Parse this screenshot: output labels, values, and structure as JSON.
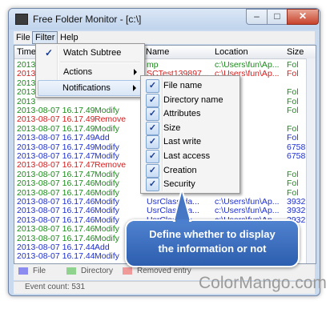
{
  "window": {
    "title": "Free Folder Monitor - [c:\\]",
    "controls": {
      "minimize": "–",
      "maximize": "□",
      "close": "✕"
    }
  },
  "menubar": {
    "items": [
      "File",
      "Filter",
      "Help"
    ]
  },
  "columns": [
    "Times",
    "Name",
    "Location",
    "Size"
  ],
  "rows": [
    {
      "time": "2013",
      "action": "",
      "name": "mp",
      "location": "c:\\Users\\fun\\Ap...",
      "size": "Fol",
      "color": "#1a8a1a"
    },
    {
      "time": "2013",
      "action": "",
      "name": "SCTest139897...",
      "location": "c:\\Users\\fun\\Ap...",
      "size": "Fol",
      "color": "#d41c1c"
    },
    {
      "time": "2013",
      "action": "",
      "name": "",
      "location": "",
      "size": "",
      "color": "#1a8a1a"
    },
    {
      "time": "2013",
      "action": "",
      "name": "",
      "location": "",
      "size": "Fol",
      "color": "#1a8a1a"
    },
    {
      "time": "2013",
      "action": "",
      "name": "",
      "location": "",
      "size": "Fol",
      "color": "#1a8a1a"
    },
    {
      "time": "2013-08-07 16.17.49",
      "action": "Modify",
      "name": "",
      "location": "",
      "size": "Fol",
      "color": "#1a8a1a"
    },
    {
      "time": "2013-08-07 16.17.49",
      "action": "Remove",
      "name": "",
      "location": "",
      "size": "",
      "color": "#d41c1c"
    },
    {
      "time": "2013-08-07 16.17.49",
      "action": "Modify",
      "name": "",
      "location": "",
      "size": "Fol",
      "color": "#1a8a1a"
    },
    {
      "time": "2013-08-07 16.17.49",
      "action": "Add",
      "name": "",
      "location": "",
      "size": "Fol",
      "color": "#1e2fd0"
    },
    {
      "time": "2013-08-07 16.17.49",
      "action": "Modify",
      "name": "",
      "location": "",
      "size": "6758",
      "color": "#1e2fd0"
    },
    {
      "time": "2013-08-07 16.17.47",
      "action": "Modify",
      "name": "",
      "location": "",
      "size": "6758",
      "color": "#1e2fd0"
    },
    {
      "time": "2013-08-07 16.17.47",
      "action": "Remove",
      "name": "",
      "location": "",
      "size": "",
      "color": "#d41c1c"
    },
    {
      "time": "2013-08-07 16.17.47",
      "action": "Modify",
      "name": "",
      "location": "",
      "size": "Fol",
      "color": "#1a8a1a"
    },
    {
      "time": "2013-08-07 16.17.46",
      "action": "Modify",
      "name": "",
      "location": "",
      "size": "Fol",
      "color": "#1a8a1a"
    },
    {
      "time": "2013-08-07 16.17.46",
      "action": "Modify",
      "name": "",
      "location": "",
      "size": "Fol",
      "color": "#1a8a1a"
    },
    {
      "time": "2013-08-07 16.17.46",
      "action": "Modify",
      "name": "UsrClass.da...",
      "location": "c:\\Users\\fun\\Ap...",
      "size": "3932",
      "color": "#1e2fd0"
    },
    {
      "time": "2013-08-07 16.17.46",
      "action": "Modify",
      "name": "UsrClass.da...",
      "location": "c:\\Users\\fun\\Ap...",
      "size": "3932",
      "color": "#1e2fd0"
    },
    {
      "time": "2013-08-07 16.17.46",
      "action": "Modify",
      "name": "UsrClass.da...",
      "location": "c:\\Users\\fun\\Ap...",
      "size": "3932",
      "color": "#1e2fd0"
    },
    {
      "time": "2013-08-07 16.17.46",
      "action": "Modify",
      "name": "",
      "location": "",
      "size": "Fol",
      "color": "#1a8a1a"
    },
    {
      "time": "2013-08-07 16.17.46",
      "action": "Modify",
      "name": "",
      "location": "",
      "size": "Fol",
      "color": "#1a8a1a"
    },
    {
      "time": "2013-08-07 16.17.44",
      "action": "Add",
      "name": "",
      "location": "",
      "size": "",
      "color": "#1e2fd0"
    },
    {
      "time": "2013-08-07 16.17.44",
      "action": "Modify",
      "name": "",
      "location": "",
      "size": "",
      "color": "#1e2fd0"
    }
  ],
  "filter_menu": {
    "items": [
      {
        "label": "Watch Subtree",
        "checked": true
      },
      {
        "label": "Actions",
        "submenu": true
      },
      {
        "label": "Notifications",
        "submenu": true
      }
    ]
  },
  "notifications_menu": {
    "items": [
      "File name",
      "Directory name",
      "Attributes",
      "Size",
      "Last write",
      "Last access",
      "Creation",
      "Security"
    ]
  },
  "legend": [
    {
      "label": "File",
      "color": "#8c8cf0"
    },
    {
      "label": "Directory",
      "color": "#8fd38f"
    },
    {
      "label": "Removed entry",
      "color": "#f09a9a"
    }
  ],
  "status": {
    "text": "Event count: 531"
  },
  "callout": {
    "line1": "Define whether to display",
    "line2": "the information or not"
  },
  "brand": {
    "text": "ColorMango.com"
  }
}
